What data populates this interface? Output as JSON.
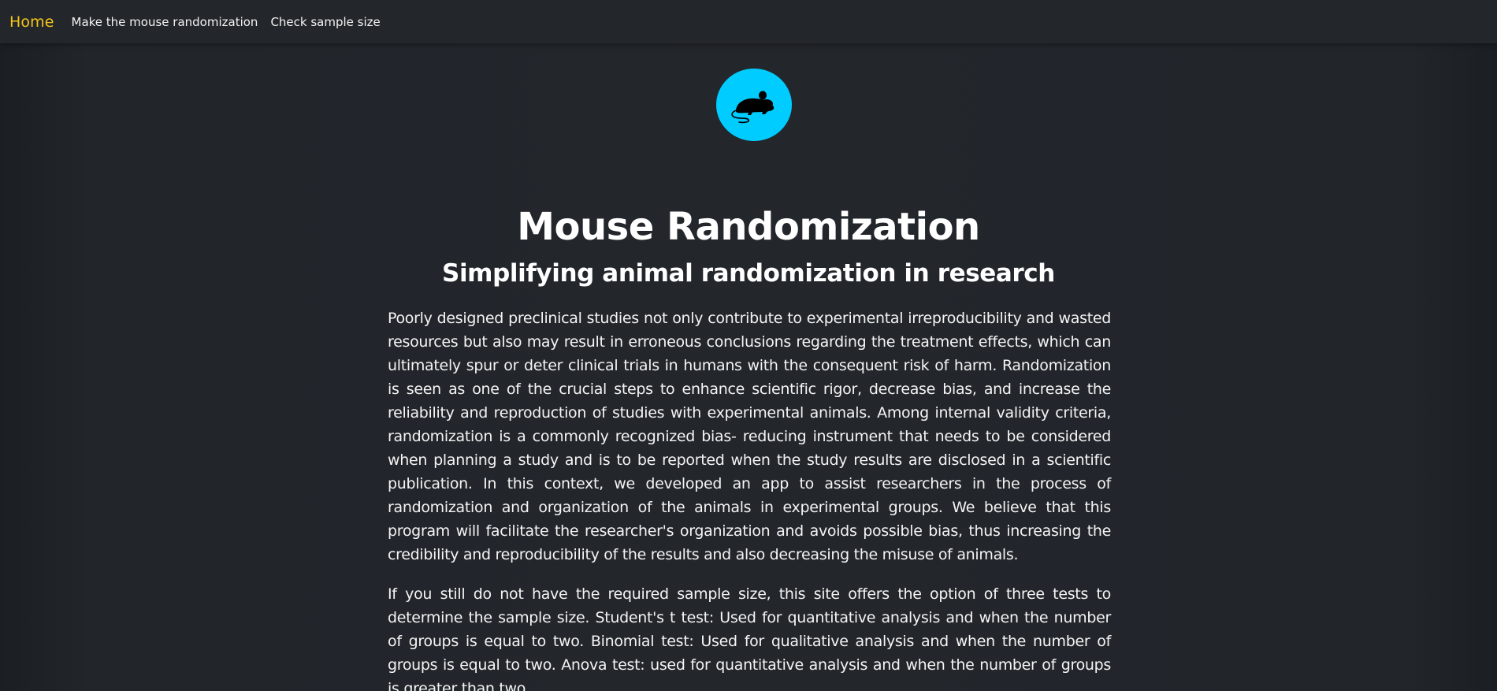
{
  "nav": {
    "brand": "Home",
    "links": [
      "Make the mouse randomization",
      "Check sample size"
    ]
  },
  "logo": {
    "icon": "mouse-icon",
    "background_color": "#00ccff"
  },
  "hero": {
    "title": "Mouse Randomization",
    "subtitle": "Simplifying animal randomization in research"
  },
  "body": {
    "paragraphs": [
      "Poorly designed preclinical studies not only contribute to experimental irreproducibility and wasted resources but also may result in erroneous conclusions regarding the treatment effects, which can ultimately spur or deter clinical trials in humans with the consequent risk of harm. Randomization is seen as one of the crucial steps to enhance scientific rigor, decrease bias, and increase the reliability and reproduction of studies with experimental animals. Among internal validity criteria, randomization is a commonly recognized bias- reducing instrument that needs to be considered when planning a study and is to be reported when the study results are disclosed in a scientific publication. In this context, we developed an app to assist researchers in the process of randomization and organization of the animals in experimental groups. We believe that this program will facilitate the researcher's organization and avoids possible bias, thus increasing the credibility and reproducibility of the results and also decreasing the misuse of animals.",
      "If you still do not have the required sample size, this site offers the option of three tests to determine the sample size. Student's t test: Used for quantitative analysis and when the number of groups is equal to two. Binomial test: Used for qualitative analysis and when the number of groups is equal to two. Anova test: used for quantitative analysis and when the number of groups is greater than two."
    ]
  },
  "colors": {
    "background": "#212529",
    "brand_accent": "#f5c518",
    "logo_circle": "#00ccff"
  }
}
